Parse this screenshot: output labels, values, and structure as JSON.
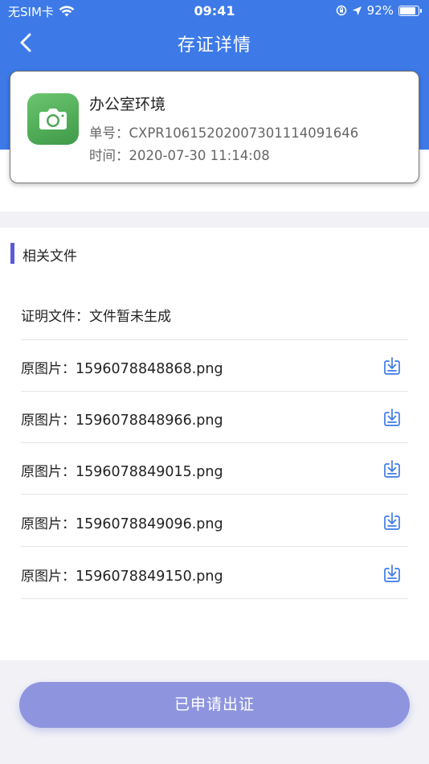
{
  "status_bar": {
    "carrier": "无SIM卡",
    "time": "09:41",
    "battery": "92%",
    "battery_level": 0.92
  },
  "nav": {
    "title": "存证详情"
  },
  "record": {
    "name": "办公室环境",
    "number_label": "单号：",
    "number": "CXPR10615202007301114091646",
    "time_label": "时间：",
    "time": "2020-07-30 11:14:08",
    "icon": "camera-icon",
    "icon_color": "#4caf50"
  },
  "files": {
    "section_title": "相关文件",
    "proof_label": "证明文件：",
    "proof_value": "文件暂未生成",
    "image_label": "原图片：",
    "images": [
      "1596078848868.png",
      "1596078848966.png",
      "1596078849015.png",
      "1596078849096.png",
      "1596078849150.png"
    ]
  },
  "actions": {
    "apply_label": "已申请出证"
  },
  "colors": {
    "header": "#3d7ae8",
    "accent_marker": "#5b5bd6",
    "button": "#8e95de",
    "download_icon": "#3d7ae8"
  }
}
